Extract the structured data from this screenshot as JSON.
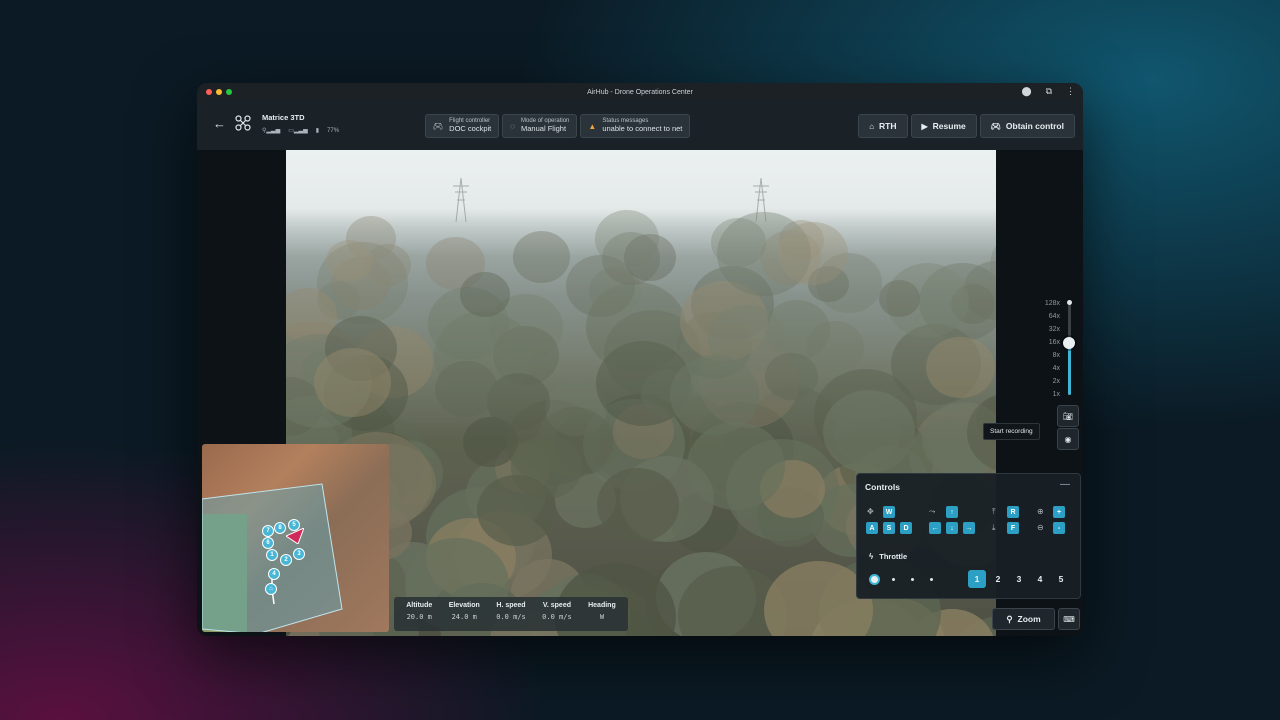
{
  "window": {
    "title": "AirHub - Drone Operations Center"
  },
  "drone": {
    "name": "Matrice 3TD",
    "battery": "77%"
  },
  "chips": {
    "flight_controller": {
      "label": "Flight controller",
      "value": "DOC cockpit"
    },
    "mode": {
      "label": "Mode of operation",
      "value": "Manual Flight"
    },
    "status": {
      "label": "Status messages",
      "value": "unable to connect to net"
    }
  },
  "actions": {
    "rth": "RTH",
    "resume": "Resume",
    "obtain": "Obtain control"
  },
  "zoom": {
    "levels": [
      "128x",
      "64x",
      "32x",
      "16x",
      "8x",
      "4x",
      "2x",
      "1x"
    ],
    "current": "16x",
    "button": "Zoom"
  },
  "recording": {
    "tooltip": "Start recording"
  },
  "telemetry": {
    "headers": [
      "Altitude",
      "Elevation",
      "H. speed",
      "V. speed",
      "Heading"
    ],
    "values": [
      "20.0 m",
      "24.0 m",
      "0.0 m/s",
      "0.0 m/s",
      "W"
    ]
  },
  "controls": {
    "title": "Controls",
    "keys_move": [
      "W",
      "A",
      "S",
      "D"
    ],
    "keys_rotate": [
      "↑",
      "←",
      "↓",
      "→"
    ],
    "keys_alt": [
      "R",
      "F"
    ],
    "keys_zoom": [
      "+",
      "-"
    ],
    "throttle_label": "Throttle",
    "gears": [
      "1",
      "2",
      "3",
      "4",
      "5"
    ],
    "active_gear": "1"
  },
  "minimap": {
    "waypoints": [
      "7",
      "8",
      "5",
      "6",
      "2",
      "3",
      "1",
      "4"
    ]
  },
  "colors": {
    "accent": "#2ca0c4",
    "warning": "#f0a33a"
  }
}
